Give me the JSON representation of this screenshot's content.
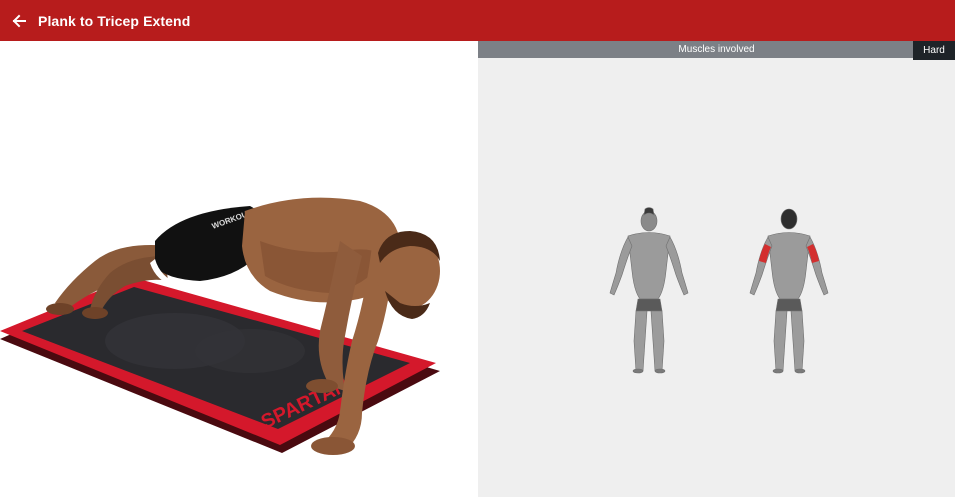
{
  "header": {
    "title": "Plank to Tricep Extend",
    "back_icon": "arrow-left-icon",
    "color": "#b71c1c"
  },
  "illustration": {
    "mat_text": "SPARTAN",
    "shorts_text": "WORKOUT",
    "mat_color": "#d4182b"
  },
  "muscles_panel": {
    "label": "Muscles involved",
    "difficulty": "Hard",
    "highlight_color": "#d32f2f"
  }
}
